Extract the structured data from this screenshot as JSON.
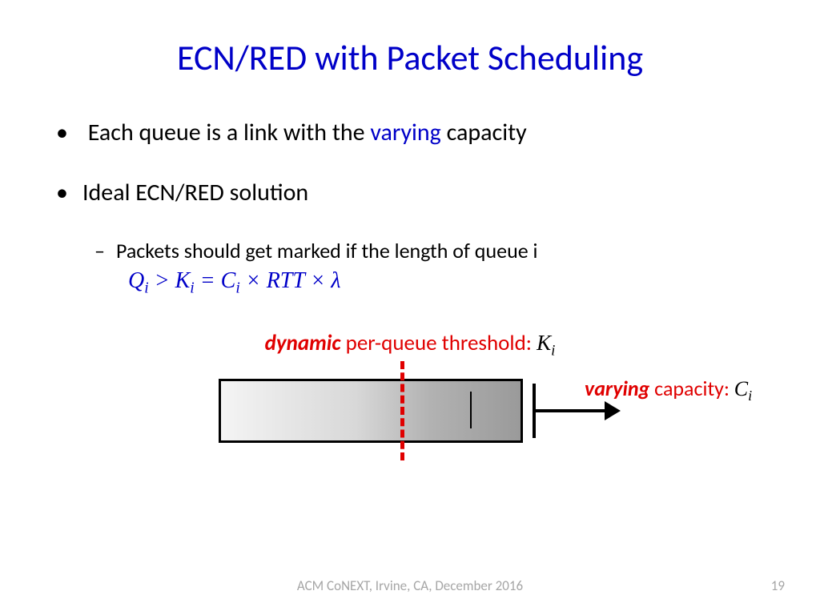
{
  "title": "ECN/RED with Packet Scheduling",
  "bullet1_pre": "Each queue is a link with the ",
  "bullet1_hl": "varying",
  "bullet1_post": " capacity",
  "bullet2": "Ideal ECN/RED solution",
  "bullet2_sub": "Packets should get marked if the length of queue i",
  "formula": {
    "q": "Q",
    "k": "K",
    "c": "C",
    "i": "i",
    "gt": " > ",
    "eq": " = ",
    "times": " × ",
    "rtt": "RTT",
    "lambda": "λ"
  },
  "caption_pre_bold": "dynamic",
  "caption_mid": " per-queue threshold: ",
  "caption_var": "K",
  "cap_label_bold": "varying",
  "cap_label_mid": " capacity: ",
  "cap_label_var": "C",
  "sub_i": "i",
  "footer": "ACM CoNEXT, Irvine, CA, December 2016",
  "page": "19"
}
